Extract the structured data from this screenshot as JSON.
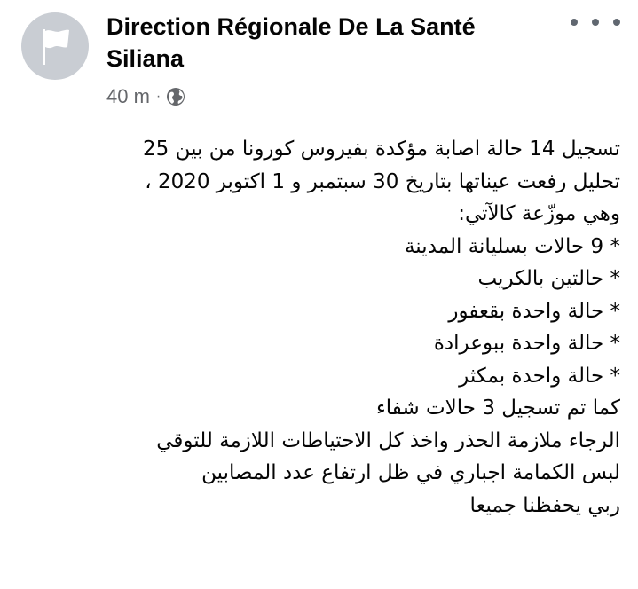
{
  "post": {
    "author": {
      "name_line1": "Direction Régionale De La Santé",
      "name_line2": "Siliana",
      "avatar_icon": "flag-icon"
    },
    "timestamp": "40 m",
    "separator": "·",
    "audience_icon": "globe-icon",
    "menu_icon": "more-options-icon",
    "body_lines": [
      "تسجيل 14 حالة اصابة مؤكدة بفيروس كورونا من بين 25",
      "تحليل رفعت عيناتها بتاريخ 30 سبتمبر و 1 اكتوبر 2020 ،",
      "وهي موزّعة كالآتي:",
      "* 9 حالات بسليانة المدينة",
      "* حالتين بالكريب",
      "* حالة واحدة بقعفور",
      "* حالة واحدة ببوعرادة",
      "* حالة واحدة بمكثر",
      "كما تم تسجيل 3 حالات شفاء",
      "الرجاء ملازمة الحذر واخذ كل الاحتياطات اللازمة للتوقي",
      "لبس الكمامة اجباري في ظل ارتفاع عدد المصابين",
      "ربي يحفظنا جميعا"
    ]
  },
  "colors": {
    "text": "#050505",
    "secondary_text": "#65676b",
    "avatar_bg": "#c9cdd3",
    "avatar_flag": "#ffffff",
    "menu_dots": "#606770"
  }
}
